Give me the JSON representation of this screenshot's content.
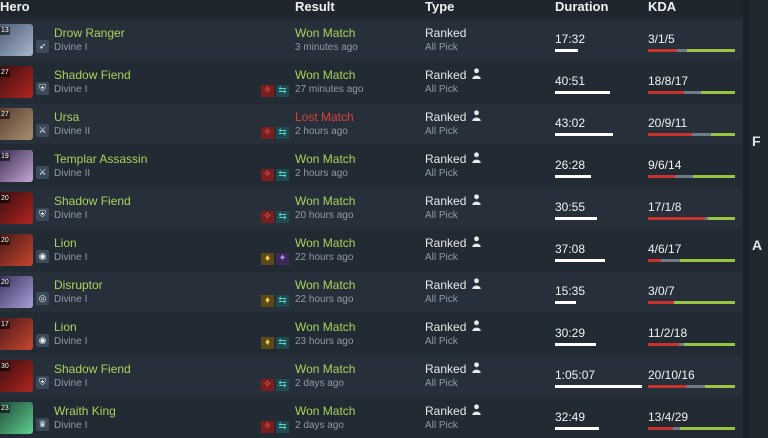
{
  "headers": {
    "hero": "Hero",
    "result": "Result",
    "type": "Type",
    "duration": "Duration",
    "kda": "KDA"
  },
  "colors": {
    "won": "#a6d45b",
    "lost": "#d6423a",
    "kills": "#c8342c",
    "deaths": "#6f7a85",
    "assists": "#99c441"
  },
  "matches": [
    {
      "level": "13",
      "hero": "Drow Ranger",
      "rank": "Divine I",
      "result": "Won Match",
      "outcome": "won",
      "ago": "3 minutes ago",
      "type": "Ranked",
      "party": false,
      "mode": "All Pick",
      "duration": "17:32",
      "duration_fraction": 0.27,
      "kda": "3/1/5",
      "k": 3,
      "d": 1,
      "a": 5,
      "items": [],
      "portrait_colors": [
        "#4b5d78",
        "#a9b7cc"
      ],
      "rank_icon": "bow-icon"
    },
    {
      "level": "27",
      "hero": "Shadow Fiend",
      "rank": "Divine I",
      "result": "Won Match",
      "outcome": "won",
      "ago": "27 minutes ago",
      "type": "Ranked",
      "party": true,
      "mode": "All Pick",
      "duration": "40:51",
      "duration_fraction": 0.63,
      "kda": "18/8/17",
      "k": 18,
      "d": 8,
      "a": 17,
      "items": [
        "red-item-icon",
        "teal-item-icon"
      ],
      "portrait_colors": [
        "#3a1010",
        "#b3241f"
      ],
      "rank_icon": "shield-icon"
    },
    {
      "level": "27",
      "hero": "Ursa",
      "rank": "Divine II",
      "result": "Lost Match",
      "outcome": "lost",
      "ago": "2 hours ago",
      "type": "Ranked",
      "party": true,
      "mode": "All Pick",
      "duration": "43:02",
      "duration_fraction": 0.67,
      "kda": "20/9/11",
      "k": 20,
      "d": 9,
      "a": 11,
      "items": [
        "red-item-icon",
        "teal-item-icon"
      ],
      "portrait_colors": [
        "#5a4030",
        "#a88f70"
      ],
      "rank_icon": "claw-icon"
    },
    {
      "level": "19",
      "hero": "Templar Assassin",
      "rank": "Divine II",
      "result": "Won Match",
      "outcome": "won",
      "ago": "2 hours ago",
      "type": "Ranked",
      "party": true,
      "mode": "All Pick",
      "duration": "26:28",
      "duration_fraction": 0.41,
      "kda": "9/6/14",
      "k": 9,
      "d": 6,
      "a": 14,
      "items": [
        "red-item-icon",
        "teal-item-icon"
      ],
      "portrait_colors": [
        "#3a2f4f",
        "#c7a7d8"
      ],
      "rank_icon": "claw-icon"
    },
    {
      "level": "20",
      "hero": "Shadow Fiend",
      "rank": "Divine I",
      "result": "Won Match",
      "outcome": "won",
      "ago": "20 hours ago",
      "type": "Ranked",
      "party": true,
      "mode": "All Pick",
      "duration": "30:55",
      "duration_fraction": 0.48,
      "kda": "17/1/8",
      "k": 17,
      "d": 1,
      "a": 8,
      "items": [
        "red-item-icon",
        "teal-item-icon"
      ],
      "portrait_colors": [
        "#3a1010",
        "#b3241f"
      ],
      "rank_icon": "shield-icon"
    },
    {
      "level": "20",
      "hero": "Lion",
      "rank": "Divine I",
      "result": "Won Match",
      "outcome": "won",
      "ago": "22 hours ago",
      "type": "Ranked",
      "party": true,
      "mode": "All Pick",
      "duration": "37:08",
      "duration_fraction": 0.58,
      "kda": "4/6/17",
      "k": 4,
      "d": 6,
      "a": 17,
      "items": [
        "yellow-item-icon",
        "purple-item-icon"
      ],
      "portrait_colors": [
        "#4a1818",
        "#c8462e"
      ],
      "rank_icon": "orb-icon"
    },
    {
      "level": "20",
      "hero": "Disruptor",
      "rank": "Divine I",
      "result": "Won Match",
      "outcome": "won",
      "ago": "22 hours ago",
      "type": "Ranked",
      "party": true,
      "mode": "All Pick",
      "duration": "15:35",
      "duration_fraction": 0.24,
      "kda": "3/0/7",
      "k": 3,
      "d": 0,
      "a": 7,
      "items": [
        "yellow-item-icon",
        "teal-item-icon"
      ],
      "portrait_colors": [
        "#3b3560",
        "#a9a0d9"
      ],
      "rank_icon": "ring-icon"
    },
    {
      "level": "17",
      "hero": "Lion",
      "rank": "Divine I",
      "result": "Won Match",
      "outcome": "won",
      "ago": "23 hours ago",
      "type": "Ranked",
      "party": true,
      "mode": "All Pick",
      "duration": "30:29",
      "duration_fraction": 0.47,
      "kda": "11/2/18",
      "k": 11,
      "d": 2,
      "a": 18,
      "items": [
        "yellow-item-icon",
        "teal-item-icon"
      ],
      "portrait_colors": [
        "#4a1818",
        "#c8462e"
      ],
      "rank_icon": "orb-icon"
    },
    {
      "level": "30",
      "hero": "Shadow Fiend",
      "rank": "Divine I",
      "result": "Won Match",
      "outcome": "won",
      "ago": "2 days ago",
      "type": "Ranked",
      "party": true,
      "mode": "All Pick",
      "duration": "1:05:07",
      "duration_fraction": 1.0,
      "kda": "20/10/16",
      "k": 20,
      "d": 10,
      "a": 16,
      "items": [
        "red-item-icon",
        "teal-item-icon"
      ],
      "portrait_colors": [
        "#3a1010",
        "#b3241f"
      ],
      "rank_icon": "shield-icon"
    },
    {
      "level": "23",
      "hero": "Wraith King",
      "rank": "Divine I",
      "result": "Won Match",
      "outcome": "won",
      "ago": "2 days ago",
      "type": "Ranked",
      "party": true,
      "mode": "All Pick",
      "duration": "32:49",
      "duration_fraction": 0.5,
      "kda": "13/4/29",
      "k": 13,
      "d": 4,
      "a": 29,
      "items": [
        "red-item-icon",
        "teal-item-icon"
      ],
      "portrait_colors": [
        "#1f4a3a",
        "#5fd08f"
      ],
      "rank_icon": "crown-icon"
    }
  ],
  "sidebar": {
    "glyph_1": "F",
    "glyph_2": "A"
  }
}
